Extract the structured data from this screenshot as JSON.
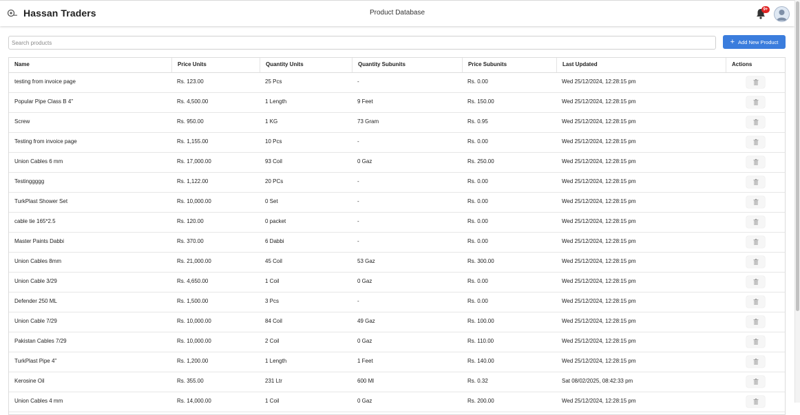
{
  "header": {
    "brand": "Hassan Traders",
    "page_title": "Product Database",
    "notification_count": "9+",
    "logo_icon": "hardware-logo-icon",
    "bell_icon": "bell-icon",
    "avatar_icon": "user-avatar-icon"
  },
  "toolbar": {
    "search_placeholder": "Search products",
    "search_value": "",
    "add_label": "Add New Product",
    "add_icon": "plus-icon"
  },
  "colors": {
    "accent": "#3b7ddd",
    "badge": "#e02424"
  },
  "table": {
    "columns": [
      "Name",
      "Price Units",
      "Quantity Units",
      "Quantity Subunits",
      "Price Subunits",
      "Last Updated",
      "Actions"
    ],
    "delete_icon": "trash-icon",
    "rows": [
      {
        "name": "testing from invoice page",
        "price_units": "Rs. 123.00",
        "qty_units": "25 Pcs",
        "qty_subunits": "-",
        "price_subunits": "Rs. 0.00",
        "updated": "Wed 25/12/2024, 12:28:15 pm"
      },
      {
        "name": "Popular Pipe Class B 4\"",
        "price_units": "Rs. 4,500.00",
        "qty_units": "1 Length",
        "qty_subunits": "9 Feet",
        "price_subunits": "Rs. 150.00",
        "updated": "Wed 25/12/2024, 12:28:15 pm"
      },
      {
        "name": "Screw",
        "price_units": "Rs. 950.00",
        "qty_units": "1 KG",
        "qty_subunits": "73 Gram",
        "price_subunits": "Rs. 0.95",
        "updated": "Wed 25/12/2024, 12:28:15 pm"
      },
      {
        "name": "Testing from invoice page",
        "price_units": "Rs. 1,155.00",
        "qty_units": "10 Pcs",
        "qty_subunits": "-",
        "price_subunits": "Rs. 0.00",
        "updated": "Wed 25/12/2024, 12:28:15 pm"
      },
      {
        "name": "Union Cables 6 mm",
        "price_units": "Rs. 17,000.00",
        "qty_units": "93 Coil",
        "qty_subunits": "0 Gaz",
        "price_subunits": "Rs. 250.00",
        "updated": "Wed 25/12/2024, 12:28:15 pm"
      },
      {
        "name": "Testinggggg",
        "price_units": "Rs. 1,122.00",
        "qty_units": "20 PCs",
        "qty_subunits": "-",
        "price_subunits": "Rs. 0.00",
        "updated": "Wed 25/12/2024, 12:28:15 pm"
      },
      {
        "name": "TurkPlast Shower Set",
        "price_units": "Rs. 10,000.00",
        "qty_units": "0 Set",
        "qty_subunits": "-",
        "price_subunits": "Rs. 0.00",
        "updated": "Wed 25/12/2024, 12:28:15 pm"
      },
      {
        "name": "cable tie 165*2.5",
        "price_units": "Rs. 120.00",
        "qty_units": "0 packet",
        "qty_subunits": "-",
        "price_subunits": "Rs. 0.00",
        "updated": "Wed 25/12/2024, 12:28:15 pm"
      },
      {
        "name": "Master Paints Dabbi",
        "price_units": "Rs. 370.00",
        "qty_units": "6 Dabbi",
        "qty_subunits": "-",
        "price_subunits": "Rs. 0.00",
        "updated": "Wed 25/12/2024, 12:28:15 pm"
      },
      {
        "name": "Union Cables 8mm",
        "price_units": "Rs. 21,000.00",
        "qty_units": "45 Coil",
        "qty_subunits": "53 Gaz",
        "price_subunits": "Rs. 300.00",
        "updated": "Wed 25/12/2024, 12:28:15 pm"
      },
      {
        "name": "Union Cable 3/29",
        "price_units": "Rs. 4,650.00",
        "qty_units": "1 Coil",
        "qty_subunits": "0 Gaz",
        "price_subunits": "Rs. 0.00",
        "updated": "Wed 25/12/2024, 12:28:15 pm"
      },
      {
        "name": "Defender 250 ML",
        "price_units": "Rs. 1,500.00",
        "qty_units": "3 Pcs",
        "qty_subunits": "-",
        "price_subunits": "Rs. 0.00",
        "updated": "Wed 25/12/2024, 12:28:15 pm"
      },
      {
        "name": "Union Cable 7/29",
        "price_units": "Rs. 10,000.00",
        "qty_units": "84 Coil",
        "qty_subunits": "49 Gaz",
        "price_subunits": "Rs. 100.00",
        "updated": "Wed 25/12/2024, 12:28:15 pm"
      },
      {
        "name": "Pakistan Cables 7/29",
        "price_units": "Rs. 10,000.00",
        "qty_units": "2 Coil",
        "qty_subunits": "0 Gaz",
        "price_subunits": "Rs. 110.00",
        "updated": "Wed 25/12/2024, 12:28:15 pm"
      },
      {
        "name": "TurkPlast Pipe 4\"",
        "price_units": "Rs. 1,200.00",
        "qty_units": "1 Length",
        "qty_subunits": "1 Feet",
        "price_subunits": "Rs. 140.00",
        "updated": "Wed 25/12/2024, 12:28:15 pm"
      },
      {
        "name": "Kerosine Oil",
        "price_units": "Rs. 355.00",
        "qty_units": "231 Ltr",
        "qty_subunits": "600 Ml",
        "price_subunits": "Rs. 0.32",
        "updated": "Sat 08/02/2025, 08:42:33 pm"
      },
      {
        "name": "Union Cables 4 mm",
        "price_units": "Rs. 14,000.00",
        "qty_units": "1 Coil",
        "qty_subunits": "0 Gaz",
        "price_subunits": "Rs. 200.00",
        "updated": "Wed 25/12/2024, 12:28:15 pm"
      }
    ]
  }
}
